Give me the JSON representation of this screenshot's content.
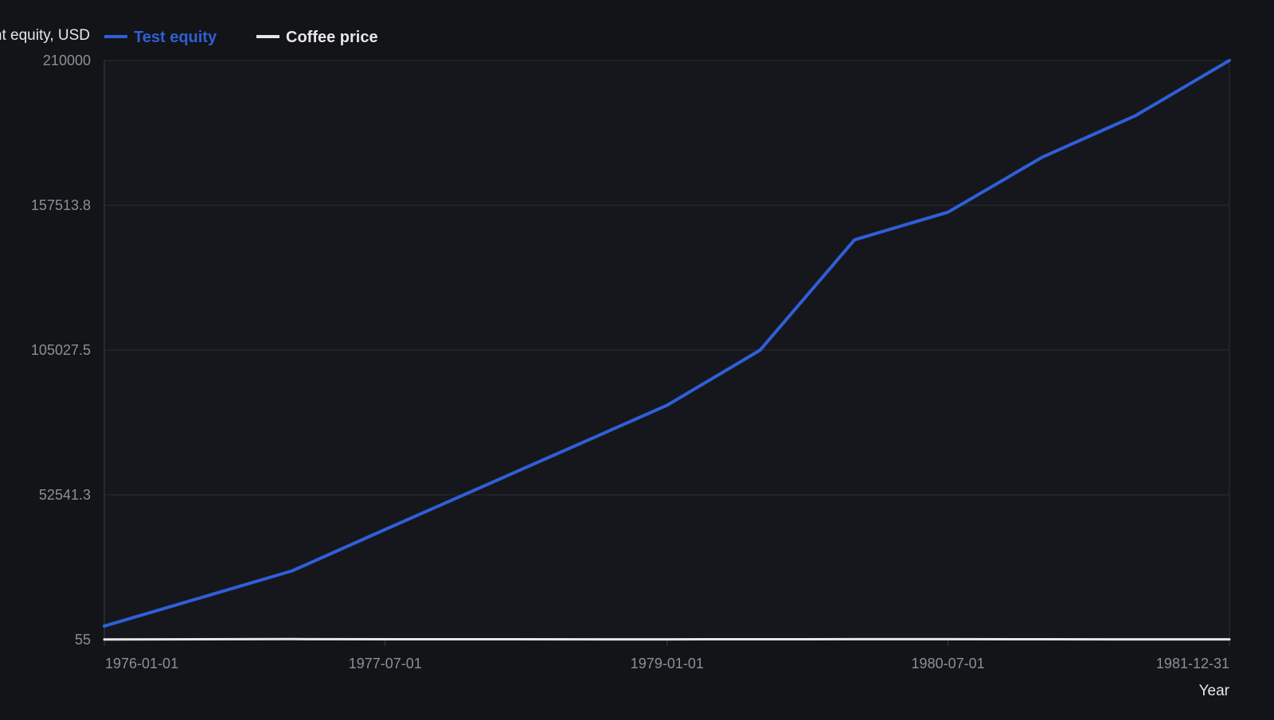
{
  "colors": {
    "background": "#131417",
    "plot_background": "#16171c",
    "grid": "#2a2c33",
    "axis": "#3a3c44",
    "tick_text": "#8d8f96",
    "title_text": "#e6e6e8",
    "legend_text_equity": "#2f5fd8",
    "legend_text_coffee": "#e6e6e8"
  },
  "chart_data": {
    "type": "line",
    "ylabel": "nt equity, USD",
    "xlabel": "Year",
    "x_ticks": [
      "1976-01-01",
      "1977-07-01",
      "1979-01-01",
      "1980-07-01",
      "1981-12-31"
    ],
    "y_ticks": [
      "210000",
      "157513.8",
      "105027.5",
      "52541.3",
      "55"
    ],
    "ylim": [
      55,
      210000
    ],
    "xlim": [
      "1976-01-01",
      "1981-12-31"
    ],
    "grid": true,
    "legend_position": "top-left",
    "series": [
      {
        "name": "Test equity",
        "color": "#2f5fd8",
        "points": [
          {
            "x": "1976-01-01",
            "y": 5000
          },
          {
            "x": "1977-01-01",
            "y": 25000
          },
          {
            "x": "1977-07-01",
            "y": 40000
          },
          {
            "x": "1979-01-01",
            "y": 85000
          },
          {
            "x": "1979-07-01",
            "y": 105000
          },
          {
            "x": "1980-01-01",
            "y": 145000
          },
          {
            "x": "1980-07-01",
            "y": 155000
          },
          {
            "x": "1981-01-01",
            "y": 175000
          },
          {
            "x": "1981-07-01",
            "y": 190000
          },
          {
            "x": "1981-12-31",
            "y": 210000
          }
        ]
      },
      {
        "name": "Coffee price",
        "color": "#e6e6e8",
        "points": [
          {
            "x": "1976-01-01",
            "y": 100
          },
          {
            "x": "1977-01-01",
            "y": 250
          },
          {
            "x": "1977-07-01",
            "y": 200
          },
          {
            "x": "1979-01-01",
            "y": 180
          },
          {
            "x": "1979-07-01",
            "y": 190
          },
          {
            "x": "1980-01-01",
            "y": 230
          },
          {
            "x": "1980-07-01",
            "y": 220
          },
          {
            "x": "1981-01-01",
            "y": 190
          },
          {
            "x": "1981-07-01",
            "y": 180
          },
          {
            "x": "1981-12-31",
            "y": 170
          }
        ]
      }
    ]
  }
}
